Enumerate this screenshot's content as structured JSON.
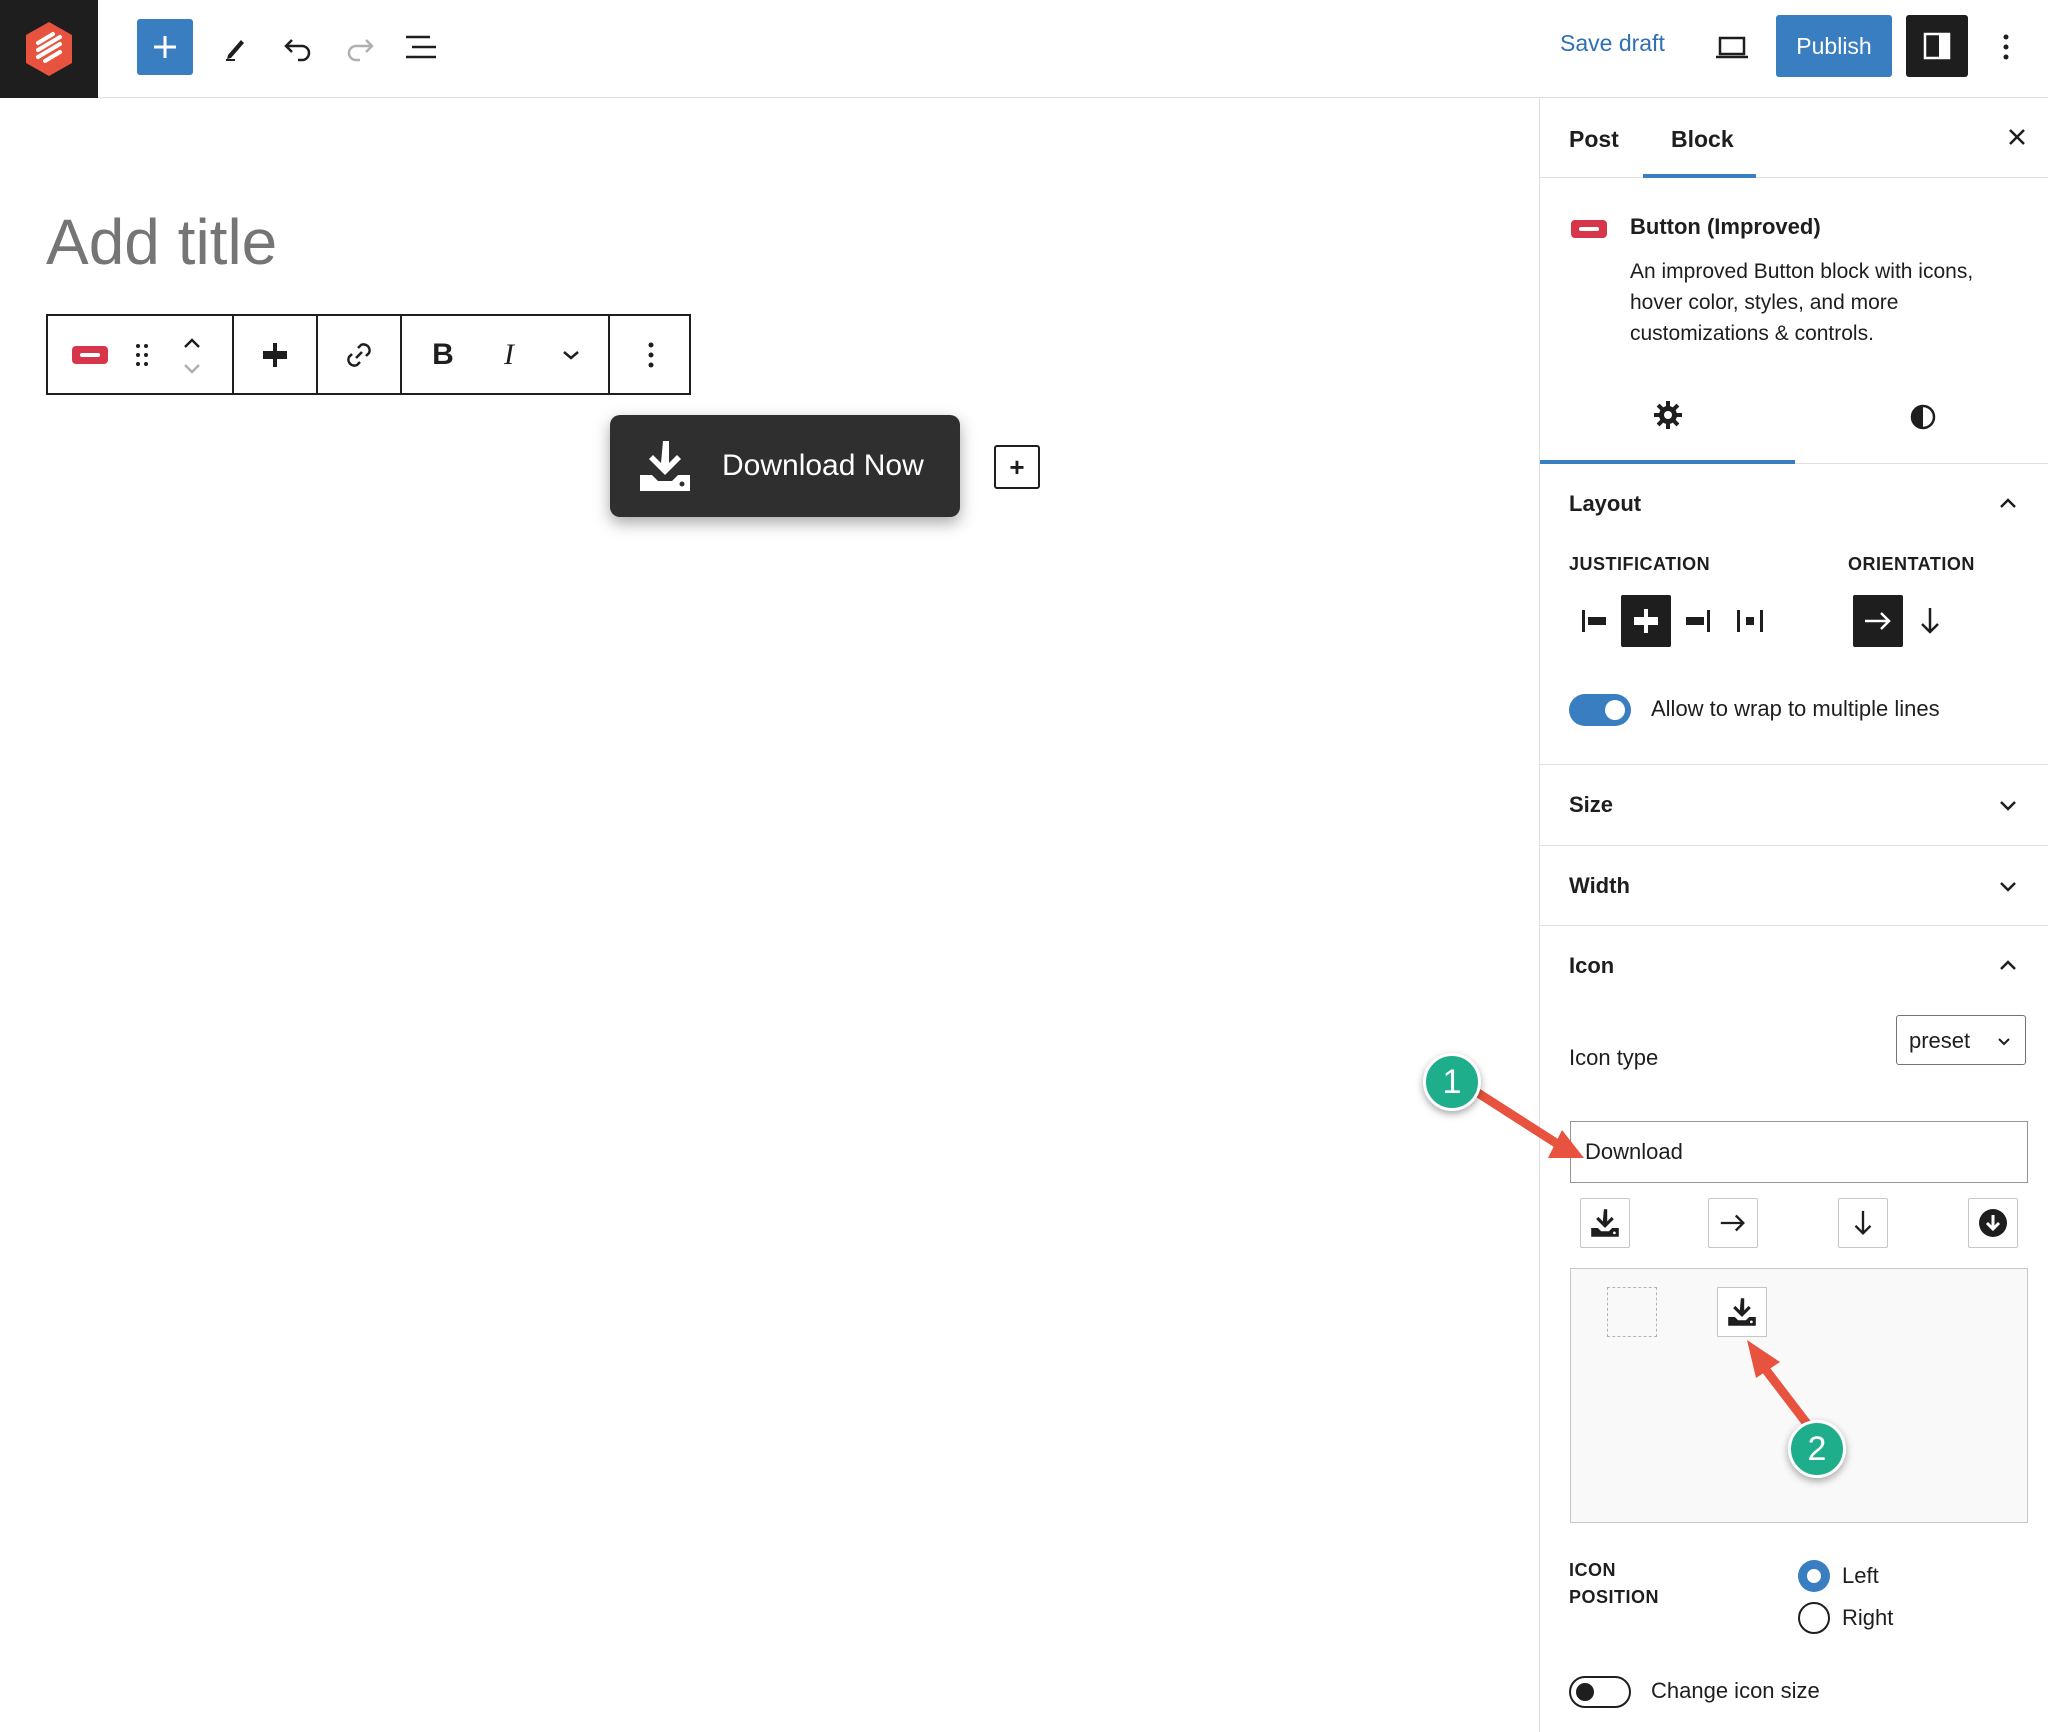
{
  "topbar": {
    "logo_icon": "wordpress-site-logo-icon",
    "inserter_icon": "plus-icon",
    "tools_icon": "pencil-icon",
    "undo_icon": "undo-icon",
    "redo_icon": "redo-icon",
    "list_view_icon": "list-view-icon",
    "save_draft": "Save draft",
    "preview_icon": "laptop-icon",
    "publish": "Publish",
    "sidebar_toggle_icon": "sidebar-icon",
    "more_icon": "vertical-ellipsis-icon",
    "accent_color": "#3a7ec2"
  },
  "editor": {
    "title_placeholder": "Add title",
    "block_toolbar": {
      "items": [
        "button-block-icon",
        "drag-handle-icon",
        "move-up-down-icon",
        "justify-center-icon",
        "link-icon",
        "B",
        "I",
        "chevron-down-icon",
        "vertical-ellipsis-icon"
      ]
    },
    "button": {
      "label": "Download Now",
      "icon": "download-icon",
      "background": "#2f2f2f"
    },
    "appender": "+"
  },
  "sidebar": {
    "tabs": [
      "Post",
      "Block"
    ],
    "active_tab": "Block",
    "close_icon": "close-icon",
    "block_card": {
      "title": "Button (Improved)",
      "description": "An improved Button block with icons, hover color, styles, and more customizations & controls.",
      "icon_color": "#d7354a"
    },
    "subtabs": [
      "gear-icon",
      "contrast-icon"
    ],
    "layout": {
      "title": "Layout",
      "justification_label": "JUSTIFICATION",
      "orientation_label": "ORIENTATION",
      "justification_options": [
        "justify-left-icon",
        "justify-center-icon",
        "justify-right-icon",
        "justify-space-between-icon"
      ],
      "justification_selected": "justify-center-icon",
      "orientation_options": [
        "arrow-right-icon",
        "arrow-down-icon"
      ],
      "orientation_selected": "arrow-right-icon",
      "wrap_label": "Allow to wrap to multiple lines",
      "wrap_enabled": true
    },
    "size": {
      "title": "Size"
    },
    "width": {
      "title": "Width"
    },
    "icon": {
      "title": "Icon",
      "icon_type_label": "Icon type",
      "icon_type_value": "preset",
      "search_value": "Download",
      "preset_icons": [
        "download-tray-icon",
        "arrow-right-icon",
        "arrow-down-icon",
        "circle-arrow-down-icon"
      ],
      "position_label_line1": "ICON",
      "position_label_line2": "POSITION",
      "position_options": [
        "Left",
        "Right"
      ],
      "position_selected": "Left",
      "change_size_label": "Change icon size",
      "change_size_enabled": false
    }
  },
  "annotations": {
    "badge_1": "1",
    "badge_2": "2",
    "badge_color": "#1fae8c",
    "arrow_color": "#e8533f"
  }
}
